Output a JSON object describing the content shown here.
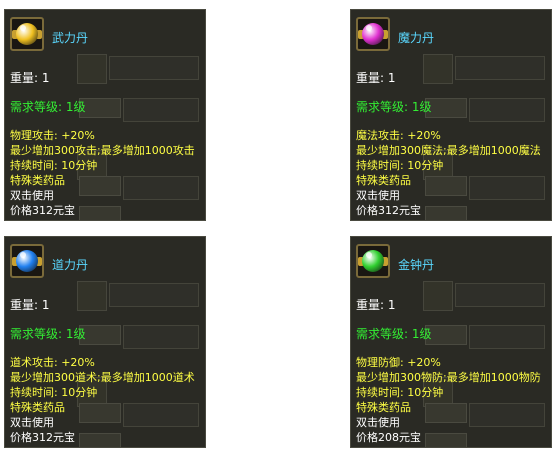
{
  "colors": {
    "panel_bg": "#2a2a24",
    "name_color": "#5ad8ff",
    "level_color": "#33ee33",
    "desc_color": "#ffff44",
    "text_color": "#ffffff"
  },
  "tooltips": [
    {
      "icon": "orb-yellow-icon",
      "orb_color": "#f0c020",
      "name": "武力丹",
      "weight": "重量:  1",
      "level": "需求等级:  1级",
      "lines": [
        "物理攻击: +20%",
        "最少增加300攻击;最多增加1000攻击",
        "持续时间: 10分钟",
        "特殊类药品"
      ],
      "use": "双击使用",
      "price": "价格312元宝"
    },
    {
      "icon": "orb-magenta-icon",
      "orb_color": "#e030d0",
      "name": "魔力丹",
      "weight": "重量:  1",
      "level": "需求等级:  1级",
      "lines": [
        "魔法攻击: +20%",
        "最少增加300魔法;最多增加1000魔法",
        "持续时间: 10分钟",
        "特殊类药品"
      ],
      "use": "双击使用",
      "price": "价格312元宝"
    },
    {
      "icon": "orb-blue-icon",
      "orb_color": "#2080f0",
      "name": "道力丹",
      "weight": "重量:  1",
      "level": "需求等级:  1级",
      "lines": [
        "道术攻击: +20%",
        "最少增加300道术;最多增加1000道术",
        "持续时间: 10分钟",
        "特殊类药品"
      ],
      "use": "双击使用",
      "price": "价格312元宝"
    },
    {
      "icon": "orb-green-icon",
      "orb_color": "#30d030",
      "name": "金钟丹",
      "weight": "重量:  1",
      "level": "需求等级:  1级",
      "lines": [
        "物理防御: +20%",
        "最少增加300物防;最多增加1000物防",
        "持续时间: 10分钟",
        "特殊类药品"
      ],
      "use": "双击使用",
      "price": "价格208元宝"
    }
  ]
}
